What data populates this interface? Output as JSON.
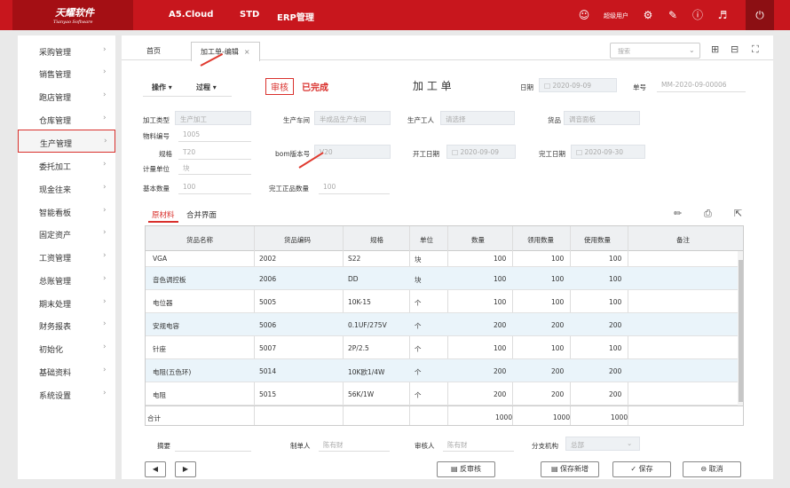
{
  "topbar": {
    "logo_cn": "天耀软件",
    "logo_en": "Tianyao Software",
    "nav": [
      "A5.Cloud",
      "STD",
      "ERP管理"
    ],
    "user": "超级用户"
  },
  "sidebar": {
    "items": [
      "采购管理",
      "销售管理",
      "跑店管理",
      "仓库管理",
      "生产管理",
      "委托加工",
      "现金往来",
      "智能看板",
      "固定资产",
      "工资管理",
      "总账管理",
      "期末处理",
      "财务报表",
      "初始化",
      "基础资料",
      "系统设置"
    ],
    "active_index": 4
  },
  "tabs": {
    "home": "首页",
    "current": "加工单-编辑",
    "search_placeholder": "搜索"
  },
  "toolbar": {
    "ops": "操作 ▾",
    "process": "过程 ▾",
    "audit": "审核",
    "status": "已完成",
    "title": "加 工 单",
    "date_label": "日期",
    "date_value": "2020-09-09",
    "no_label": "单号",
    "no_value": "MM-2020-09-00006"
  },
  "form": {
    "process_type": {
      "label": "加工类型",
      "value": "生产加工"
    },
    "workshop": {
      "label": "生产车间",
      "value": "半成品生产车间"
    },
    "worker": {
      "label": "生产工人",
      "value": "请选择"
    },
    "goods": {
      "label": "货品",
      "value": "调音面板"
    },
    "material_no": {
      "label": "物料编号",
      "value": "1005"
    },
    "spec": {
      "label": "规格",
      "value": "T20"
    },
    "bom": {
      "label": "bom版本号",
      "value": "V20"
    },
    "start_date": {
      "label": "开工日期",
      "value": "2020-09-09"
    },
    "end_date": {
      "label": "完工日期",
      "value": "2020-09-30"
    },
    "unit": {
      "label": "计量单位",
      "value": "块"
    },
    "base_qty": {
      "label": "基本数量",
      "value": "100"
    },
    "done_qty": {
      "label": "完工正品数量",
      "value": "100"
    }
  },
  "subtabs": [
    "原材料",
    "合并界面"
  ],
  "grid": {
    "headers": [
      "货品名称",
      "货品编码",
      "规格",
      "单位",
      "数量",
      "领用数量",
      "使用数量",
      "备注"
    ],
    "rows": [
      [
        "VGA",
        "2002",
        "S22",
        "块",
        "100",
        "100",
        "100"
      ],
      [
        "音色调控板",
        "2006",
        "DD",
        "块",
        "100",
        "100",
        "100"
      ],
      [
        "电位器",
        "5005",
        "10K-15",
        "个",
        "100",
        "100",
        "100"
      ],
      [
        "安规电容",
        "5006",
        "0.1UF/275V",
        "个",
        "200",
        "200",
        "200"
      ],
      [
        "针座",
        "5007",
        "2P/2.5",
        "个",
        "100",
        "100",
        "100"
      ],
      [
        "电阻(五色环)",
        "5014",
        "10K欧1/4W",
        "个",
        "200",
        "200",
        "200"
      ],
      [
        "电阻",
        "5015",
        "56K/1W",
        "个",
        "200",
        "200",
        "200"
      ]
    ],
    "total_label": "合计",
    "totals": [
      "1000",
      "1000",
      "1000"
    ]
  },
  "footer": {
    "summary_label": "摘要",
    "maker_label": "制单人",
    "maker": "陈有财",
    "auditor_label": "审核人",
    "auditor": "陈有财",
    "branch_label": "分支机构",
    "branch": "总部"
  },
  "buttons": {
    "unaudit": "反审核",
    "save_new": "保存新增",
    "save": "保存",
    "cancel": "取消"
  }
}
